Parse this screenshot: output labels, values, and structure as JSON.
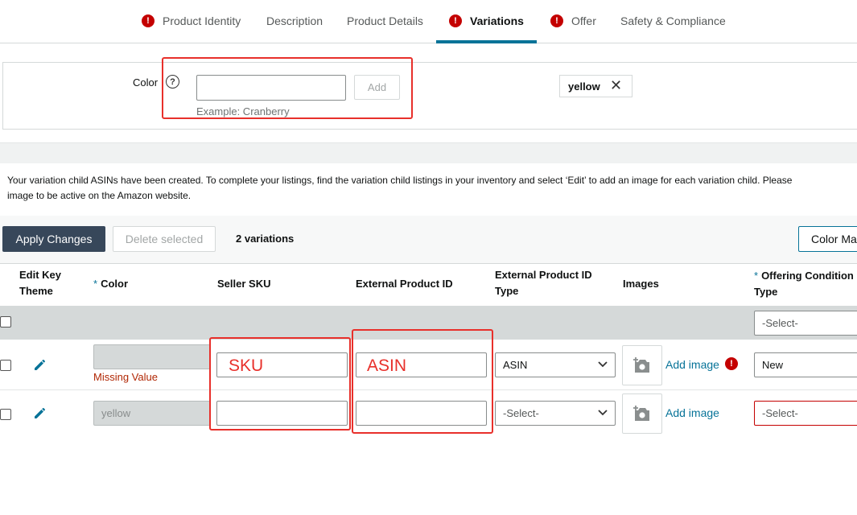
{
  "tabs": [
    {
      "label": "Product Identity",
      "error": true
    },
    {
      "label": "Description",
      "error": false
    },
    {
      "label": "Product Details",
      "error": false
    },
    {
      "label": "Variations",
      "error": true,
      "active": true
    },
    {
      "label": "Offer",
      "error": true
    },
    {
      "label": "Safety & Compliance",
      "error": false
    }
  ],
  "color_section": {
    "label": "Color",
    "help": "?",
    "input_value": "",
    "add_label": "Add",
    "example": "Example: Cranberry",
    "chips": [
      {
        "label": "yellow",
        "remove": "✕"
      }
    ]
  },
  "info_text_1": "Your variation child ASINs have been created. To complete your listings, find the variation child listings in your inventory and select ‘Edit’ to add an image for each variation child. Please",
  "info_text_2": "image to be active on the Amazon website.",
  "toolbar": {
    "apply_label": "Apply Changes",
    "delete_label": "Delete selected",
    "count_label": "2 variations",
    "color_map_label": "Color Map"
  },
  "table": {
    "headers": {
      "edit_key_theme_1": "Edit Key",
      "edit_key_theme_2": "Theme",
      "color": "Color",
      "seller_sku": "Seller SKU",
      "external_id": "External Product ID",
      "external_id_type_1": "External Product ID",
      "external_id_type_2": "Type",
      "images": "Images",
      "offering_1": "Offering Condition",
      "offering_2": "Type",
      "required_mark": "*"
    },
    "filter_row": {
      "offering": "-Select-"
    },
    "rows": [
      {
        "color": "",
        "missing": "Missing Value",
        "sku": "",
        "external_id": "",
        "id_type": "ASIN",
        "add_image": "Add image",
        "image_error": true,
        "offering": "New"
      },
      {
        "color": "yellow",
        "missing": "",
        "sku": "",
        "external_id": "",
        "id_type": "-Select-",
        "add_image": "Add image",
        "image_error": false,
        "offering": "-Select-"
      }
    ]
  },
  "annotations": {
    "sku": "SKU",
    "asin": "ASIN"
  },
  "colors": {
    "accent": "#077398",
    "error": "#c40000",
    "annotation": "#e8302b",
    "primary_button": "#37475a"
  }
}
